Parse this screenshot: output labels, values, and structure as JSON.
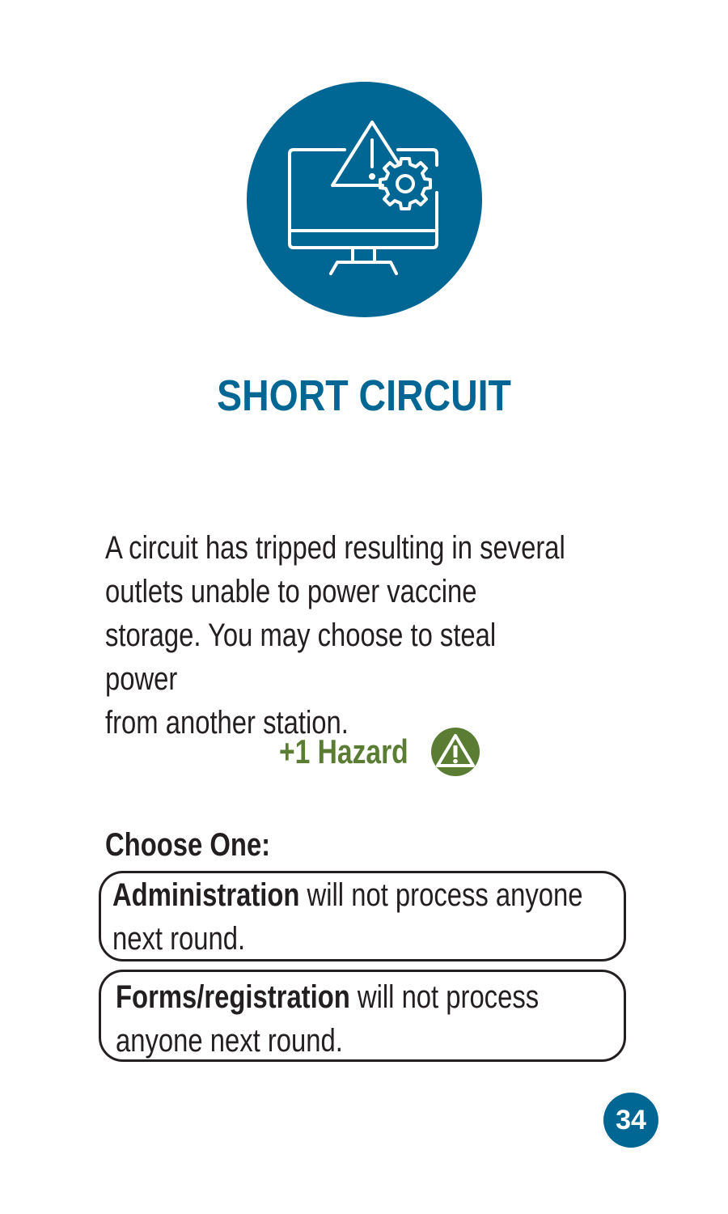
{
  "card": {
    "icon": "monitor-warning-gear-icon",
    "title": "SHORT CIRCUIT",
    "description": "A circuit has tripped resulting in several\noutlets unable to power vaccine\nstorage. You may choose to steal power\nfrom another station.",
    "hazard": {
      "label": "+1 Hazard",
      "icon": "warning-triangle-icon"
    },
    "choose_label": "Choose One:",
    "options": [
      {
        "bold": "Administration",
        "rest": " will not process anyone next round."
      },
      {
        "bold": "Forms/registration",
        "rest": " will not process anyone next round."
      }
    ],
    "page_number": "34"
  },
  "colors": {
    "primary_blue": "#006694",
    "hazard_green": "#5a7d33",
    "text": "#231f20"
  }
}
